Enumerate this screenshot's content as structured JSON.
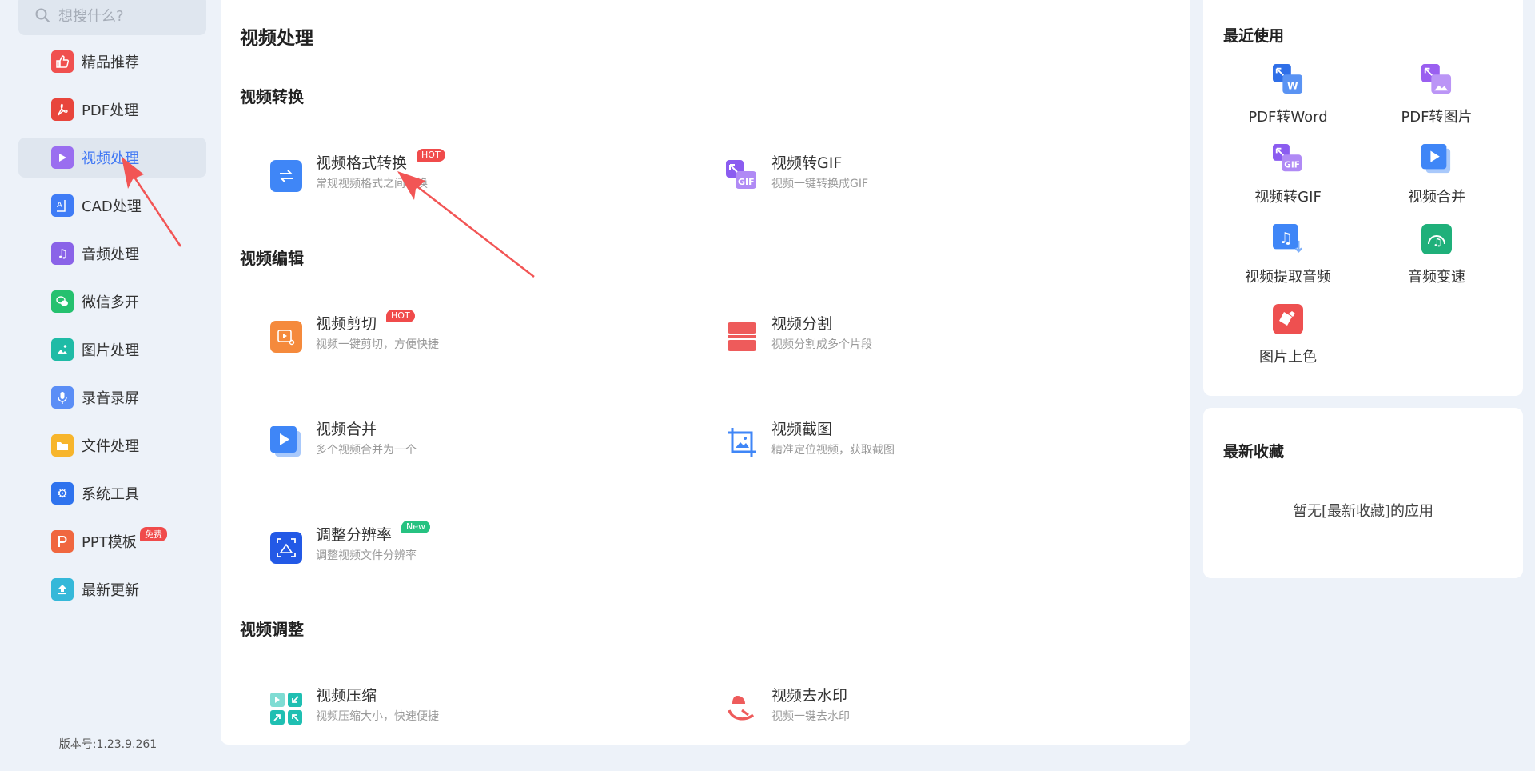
{
  "search": {
    "placeholder": "想搜什么?"
  },
  "sidebar": {
    "items": [
      {
        "label": "精品推荐",
        "icon": "thumb-up-icon",
        "color": "#f0504f"
      },
      {
        "label": "PDF处理",
        "icon": "pdf-icon",
        "color": "#e8453c"
      },
      {
        "label": "视频处理",
        "icon": "play-icon",
        "color": "#9a6ef0",
        "active": true
      },
      {
        "label": "CAD处理",
        "icon": "cad-icon",
        "color": "#3f7cf6"
      },
      {
        "label": "音频处理",
        "icon": "music-icon",
        "color": "#8a63e8"
      },
      {
        "label": "微信多开",
        "icon": "wechat-icon",
        "color": "#25c16f"
      },
      {
        "label": "图片处理",
        "icon": "image-icon",
        "color": "#1fbba6"
      },
      {
        "label": "录音录屏",
        "icon": "microphone-icon",
        "color": "#5b8ef6"
      },
      {
        "label": "文件处理",
        "icon": "folder-icon",
        "color": "#f7b52c"
      },
      {
        "label": "系统工具",
        "icon": "gear-icon",
        "color": "#2f73ee"
      },
      {
        "label": "PPT模板",
        "icon": "ppt-icon",
        "color": "#f0673f",
        "badge": "免费"
      },
      {
        "label": "最新更新",
        "icon": "upload-icon",
        "color": "#35b8d9"
      }
    ],
    "version": "版本号:1.23.9.261"
  },
  "main": {
    "title": "视频处理",
    "sections": [
      {
        "title": "视频转换"
      },
      {
        "title": "视频编辑"
      },
      {
        "title": "视频调整"
      }
    ],
    "tools": [
      {
        "name": "视频格式转换",
        "desc": "常规视频格式之间转换",
        "badge": "HOT",
        "icon": "convert-arrows-icon",
        "color": "#3f86f7"
      },
      {
        "name": "视频转GIF",
        "desc": "视频一键转换成GIF",
        "icon": "gif-icon",
        "color": "#8b5cf0"
      },
      {
        "name": "视频剪切",
        "desc": "视频一键剪切，方便快捷",
        "badge": "HOT",
        "icon": "film-cut-icon",
        "color": "#f58a3c"
      },
      {
        "name": "视频分割",
        "desc": "视频分割成多个片段",
        "icon": "split-icon",
        "color": "#ee5b5b"
      },
      {
        "name": "视频合并",
        "desc": "多个视频合并为一个",
        "icon": "video-merge-icon",
        "color": "#3f86f7"
      },
      {
        "name": "视频截图",
        "desc": "精准定位视频，获取截图",
        "icon": "crop-image-icon",
        "color": "#3f86f7"
      },
      {
        "name": "调整分辨率",
        "desc": "调整视频文件分辨率",
        "badge": "New",
        "icon": "resolution-icon",
        "color": "#2359e6"
      },
      {
        "name": "视频压缩",
        "desc": "视频压缩大小，快速便捷",
        "icon": "compress-icon",
        "color": "#1fbfb2"
      },
      {
        "name": "视频去水印",
        "desc": "视频一键去水印",
        "icon": "watermark-remove-icon",
        "color": "#ee5b5b"
      }
    ]
  },
  "recent": {
    "title": "最近使用",
    "items": [
      {
        "label": "PDF转Word",
        "icon": "pdf-to-word-icon",
        "color": "#2f6fe8"
      },
      {
        "label": "PDF转图片",
        "icon": "pdf-to-image-icon",
        "color": "#9a5ff0"
      },
      {
        "label": "视频转GIF",
        "icon": "gif-icon",
        "color": "#8b5cf0"
      },
      {
        "label": "视频合并",
        "icon": "video-merge-icon",
        "color": "#3f86f7"
      },
      {
        "label": "视频提取音频",
        "icon": "audio-extract-icon",
        "color": "#3f86f7"
      },
      {
        "label": "音频变速",
        "icon": "speed-icon",
        "color": "#1fb07a"
      },
      {
        "label": "图片上色",
        "icon": "colorize-icon",
        "color": "#ee5050"
      }
    ]
  },
  "favorites": {
    "title": "最新收藏",
    "empty_text": "暂无[最新收藏]的应用"
  }
}
